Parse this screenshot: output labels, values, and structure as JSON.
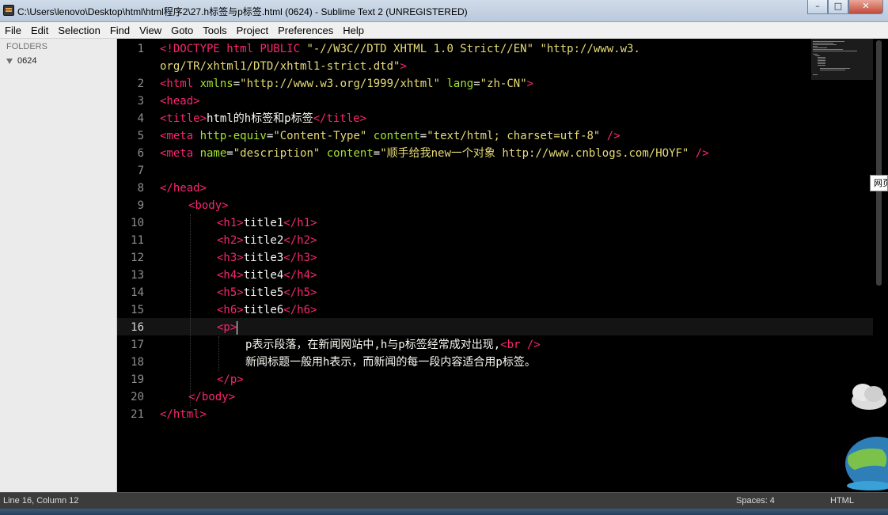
{
  "window": {
    "title": "C:\\Users\\lenovo\\Desktop\\html\\html程序2\\27.h标签与p标签.html (0624) - Sublime Text 2 (UNREGISTERED)",
    "minimize_icon": "minimize-icon",
    "maximize_icon": "maximize-icon",
    "close_icon": "close-icon"
  },
  "menu": [
    "File",
    "Edit",
    "Selection",
    "Find",
    "View",
    "Goto",
    "Tools",
    "Project",
    "Preferences",
    "Help"
  ],
  "sidebar": {
    "header": "FOLDERS",
    "folders": [
      {
        "name": "0624",
        "expanded": true
      }
    ]
  },
  "editor": {
    "gutter": [
      "1",
      "",
      "2",
      "3",
      "4",
      "5",
      "6",
      "7",
      "8",
      "9",
      "10",
      "11",
      "12",
      "13",
      "14",
      "15",
      "16",
      "17",
      "18",
      "19",
      "20",
      "21"
    ],
    "current_line": "16",
    "tokens": {
      "l1": [
        "<!DOCTYPE html PUBLIC ",
        "\"-//W3C//DTD XHTML 1.0 Strict//EN\"",
        " ",
        "\"http://www.w3."
      ],
      "l1b": [
        "org/TR/xhtml1/DTD/xhtml1-strict.dtd\"",
        ">"
      ],
      "l2": [
        "<html ",
        "xmlns",
        "=",
        "\"http://www.w3.org/1999/xhtml\"",
        " ",
        "lang",
        "=",
        "\"zh-CN\"",
        ">"
      ],
      "l3": [
        "<head>"
      ],
      "l4": [
        "<title>",
        "html的h标签和p标签",
        "</title>"
      ],
      "l5": [
        "<meta ",
        "http-equiv",
        "=",
        "\"Content-Type\"",
        " ",
        "content",
        "=",
        "\"text/html; charset=utf-8\"",
        " />"
      ],
      "l6": [
        "<meta ",
        "name",
        "=",
        "\"description\"",
        " ",
        "content",
        "=",
        "\"顺手给我new一个对象 http://www.cnblogs.com/HOYF\"",
        " />"
      ],
      "l8": [
        "</head>"
      ],
      "l9": [
        "<body>"
      ],
      "l10": [
        "<h1>",
        "title1",
        "</h1>"
      ],
      "l11": [
        "<h2>",
        "title2",
        "</h2>"
      ],
      "l12": [
        "<h3>",
        "title3",
        "</h3>"
      ],
      "l13": [
        "<h4>",
        "title4",
        "</h4>"
      ],
      "l14": [
        "<h5>",
        "title5",
        "</h5>"
      ],
      "l15": [
        "<h6>",
        "title6",
        "</h6>"
      ],
      "l16": [
        "<p>"
      ],
      "l17": [
        "p表示段落，在新闻网站中,h与p标签经常成对出现,",
        "<br />"
      ],
      "l18": [
        "新闻标题一般用h表示，而新闻的每一段内容适合用p标签。"
      ],
      "l19": [
        "</p>"
      ],
      "l20": [
        "</body>"
      ],
      "l21": [
        "</html>"
      ]
    }
  },
  "tooltip_peek": "网页",
  "status": {
    "position": "Line 16, Column 12",
    "indent": "Spaces: 4",
    "syntax": "HTML"
  },
  "colors": {
    "tag": "#f92672",
    "attr": "#a6e22e",
    "string": "#e6db74",
    "text": "#f8f8f2",
    "background": "#000000"
  }
}
